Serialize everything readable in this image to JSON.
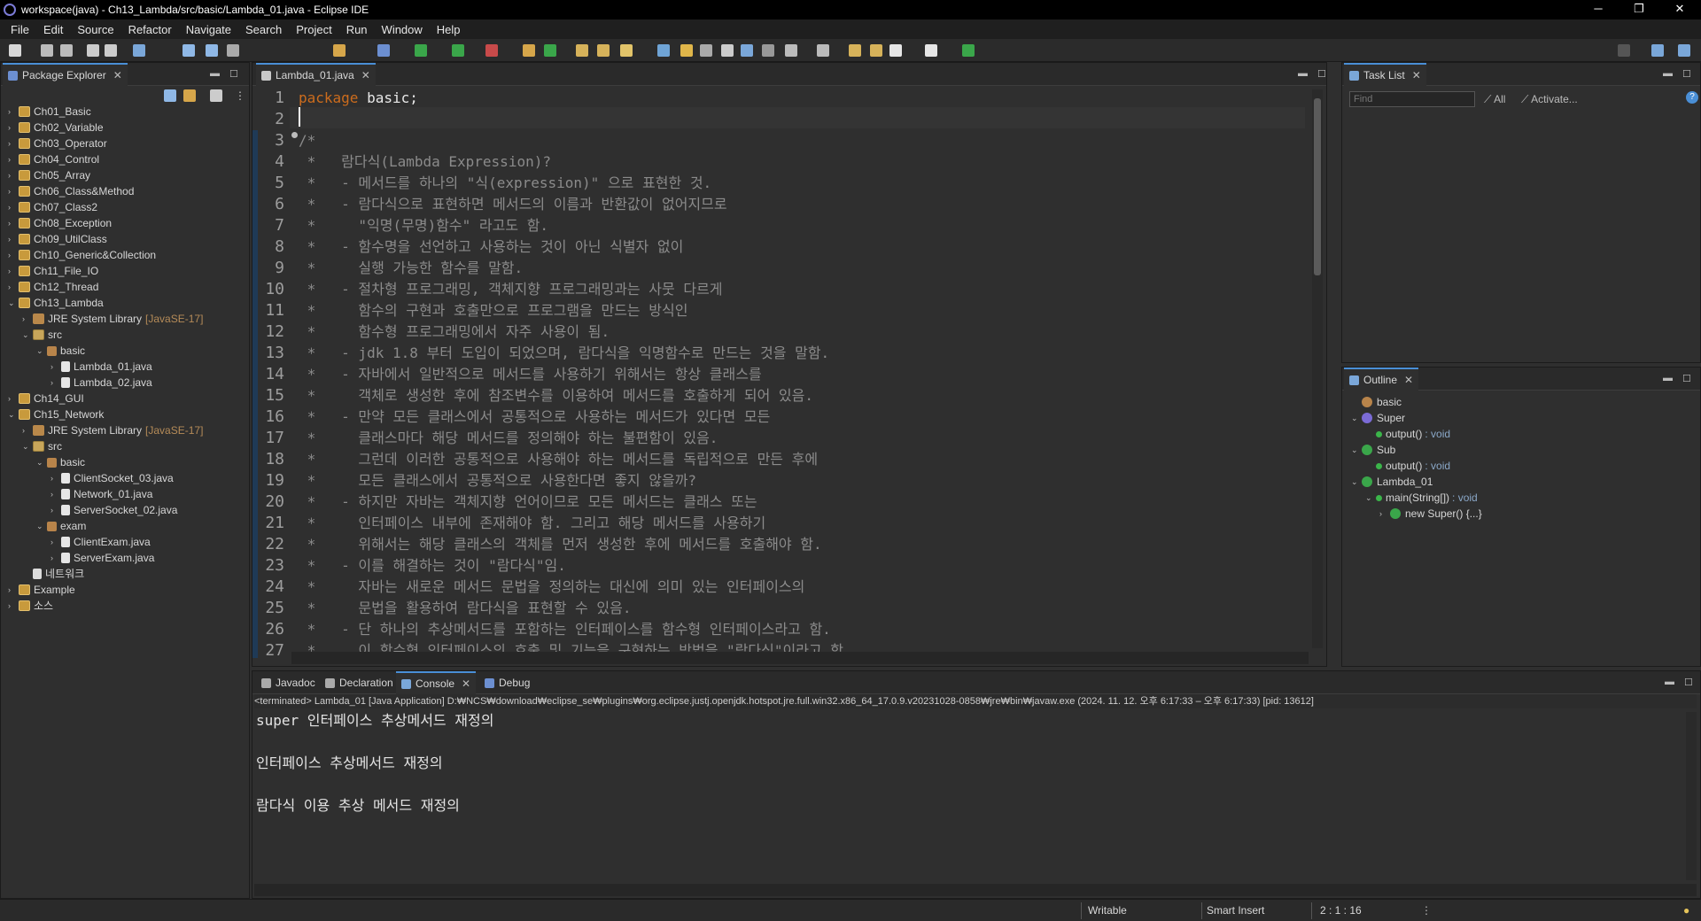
{
  "window": {
    "title": "workspace(java) - Ch13_Lambda/src/basic/Lambda_01.java - Eclipse IDE",
    "minimize": "─",
    "restore": "❐",
    "close": "✕"
  },
  "menu": [
    "File",
    "Edit",
    "Source",
    "Refactor",
    "Navigate",
    "Search",
    "Project",
    "Run",
    "Window",
    "Help"
  ],
  "package_explorer": {
    "tab": "Package Explorer",
    "tree": [
      {
        "label": "Ch01_Basic",
        "type": "proj",
        "depth": 0,
        "tw": "›"
      },
      {
        "label": "Ch02_Variable",
        "type": "proj",
        "depth": 0,
        "tw": "›"
      },
      {
        "label": "Ch03_Operator",
        "type": "proj",
        "depth": 0,
        "tw": "›"
      },
      {
        "label": "Ch04_Control",
        "type": "proj",
        "depth": 0,
        "tw": "›"
      },
      {
        "label": "Ch05_Array",
        "type": "proj",
        "depth": 0,
        "tw": "›"
      },
      {
        "label": "Ch06_Class&Method",
        "type": "proj",
        "depth": 0,
        "tw": "›"
      },
      {
        "label": "Ch07_Class2",
        "type": "proj",
        "depth": 0,
        "tw": "›"
      },
      {
        "label": "Ch08_Exception",
        "type": "proj",
        "depth": 0,
        "tw": "›"
      },
      {
        "label": "Ch09_UtilClass",
        "type": "proj",
        "depth": 0,
        "tw": "›"
      },
      {
        "label": "Ch10_Generic&Collection",
        "type": "proj",
        "depth": 0,
        "tw": "›"
      },
      {
        "label": "Ch11_File_IO",
        "type": "proj",
        "depth": 0,
        "tw": "›"
      },
      {
        "label": "Ch12_Thread",
        "type": "proj",
        "depth": 0,
        "tw": "›"
      },
      {
        "label": "Ch13_Lambda",
        "type": "proj",
        "depth": 0,
        "tw": "⌄"
      },
      {
        "label": "JRE System Library",
        "extra": "[JavaSE-17]",
        "type": "lib",
        "depth": 1,
        "tw": "›"
      },
      {
        "label": "src",
        "type": "src",
        "depth": 1,
        "tw": "⌄"
      },
      {
        "label": "basic",
        "type": "pkg",
        "depth": 2,
        "tw": "⌄"
      },
      {
        "label": "Lambda_01.java",
        "type": "java",
        "depth": 3,
        "tw": "›"
      },
      {
        "label": "Lambda_02.java",
        "type": "java",
        "depth": 3,
        "tw": "›"
      },
      {
        "label": "Ch14_GUI",
        "type": "proj",
        "depth": 0,
        "tw": "›"
      },
      {
        "label": "Ch15_Network",
        "type": "proj",
        "depth": 0,
        "tw": "⌄"
      },
      {
        "label": "JRE System Library",
        "extra": "[JavaSE-17]",
        "type": "lib",
        "depth": 1,
        "tw": "›"
      },
      {
        "label": "src",
        "type": "src",
        "depth": 1,
        "tw": "⌄"
      },
      {
        "label": "basic",
        "type": "pkg",
        "depth": 2,
        "tw": "⌄"
      },
      {
        "label": "ClientSocket_03.java",
        "type": "java",
        "depth": 3,
        "tw": "›"
      },
      {
        "label": "Network_01.java",
        "type": "java",
        "depth": 3,
        "tw": "›"
      },
      {
        "label": "ServerSocket_02.java",
        "type": "java",
        "depth": 3,
        "tw": "›"
      },
      {
        "label": "exam",
        "type": "pkg",
        "depth": 2,
        "tw": "⌄"
      },
      {
        "label": "ClientExam.java",
        "type": "java",
        "depth": 3,
        "tw": "›"
      },
      {
        "label": "ServerExam.java",
        "type": "java",
        "depth": 3,
        "tw": "›"
      },
      {
        "label": "네트워크",
        "type": "file",
        "depth": 1,
        "tw": ""
      },
      {
        "label": "Example",
        "type": "proj",
        "depth": 0,
        "tw": "›"
      },
      {
        "label": "소스",
        "type": "proj",
        "depth": 0,
        "tw": "›"
      }
    ]
  },
  "editor": {
    "tab": "Lambda_01.java",
    "lines": [
      {
        "n": "1",
        "kw": "package",
        "rest": " basic;"
      },
      {
        "n": "2",
        "text": ""
      },
      {
        "n": "3",
        "text": "/*"
      },
      {
        "n": "4",
        "text": " *   람다식(Lambda Expression)?"
      },
      {
        "n": "5",
        "text": " *   - 메서드를 하나의 \"식(expression)\" 으로 표현한 것."
      },
      {
        "n": "6",
        "text": " *   - 람다식으로 표현하면 메서드의 이름과 반환값이 없어지므로"
      },
      {
        "n": "7",
        "text": " *     \"익명(무명)함수\" 라고도 함."
      },
      {
        "n": "8",
        "text": " *   - 함수명을 선언하고 사용하는 것이 아닌 식별자 없이"
      },
      {
        "n": "9",
        "text": " *     실행 가능한 함수를 말함."
      },
      {
        "n": "10",
        "text": " *   - 절차형 프로그래밍, 객체지향 프로그래밍과는 사뭇 다르게"
      },
      {
        "n": "11",
        "text": " *     함수의 구현과 호출만으로 프로그램을 만드는 방식인"
      },
      {
        "n": "12",
        "text": " *     함수형 프로그래밍에서 자주 사용이 됨."
      },
      {
        "n": "13",
        "text": " *   - jdk 1.8 부터 도입이 되었으며, 람다식을 익명함수로 만드는 것을 말함."
      },
      {
        "n": "14",
        "text": " *   - 자바에서 일반적으로 메서드를 사용하기 위해서는 항상 클래스를"
      },
      {
        "n": "15",
        "text": " *     객체로 생성한 후에 참조변수를 이용하여 메서드를 호출하게 되어 있음."
      },
      {
        "n": "16",
        "text": " *   - 만약 모든 클래스에서 공통적으로 사용하는 메서드가 있다면 모든"
      },
      {
        "n": "17",
        "text": " *     클래스마다 해당 메서드를 정의해야 하는 불편함이 있음."
      },
      {
        "n": "18",
        "text": " *     그런데 이러한 공통적으로 사용해야 하는 메서드를 독립적으로 만든 후에"
      },
      {
        "n": "19",
        "text": " *     모든 클래스에서 공통적으로 사용한다면 좋지 않을까?"
      },
      {
        "n": "20",
        "text": " *   - 하지만 자바는 객체지향 언어이므로 모든 메서드는 클래스 또는"
      },
      {
        "n": "21",
        "text": " *     인터페이스 내부에 존재해야 함. 그리고 해당 메서드를 사용하기"
      },
      {
        "n": "22",
        "text": " *     위해서는 해당 클래스의 객체를 먼저 생성한 후에 메서드를 호출해야 함."
      },
      {
        "n": "23",
        "text": " *   - 이를 해결하는 것이 \"람다식\"임."
      },
      {
        "n": "24",
        "text": " *     자바는 새로운 메서드 문법을 정의하는 대신에 의미 있는 인터페이스의"
      },
      {
        "n": "25",
        "text": " *     문법을 활용하여 람다식을 표현할 수 있음."
      },
      {
        "n": "26",
        "text": " *   - 단 하나의 추상메서드를 포함하는 인터페이스를 함수형 인터페이스라고 함."
      },
      {
        "n": "27",
        "text": " *     이 함수형 인터페이스의 호출 및 기능을 구현하는 방법을 \"람다식\"이라고 함."
      }
    ]
  },
  "tasklist": {
    "tab": "Task List",
    "find_placeholder": "Find",
    "all": "All",
    "activate": "Activate..."
  },
  "outline": {
    "tab": "Outline",
    "items": [
      {
        "label": "basic",
        "kind": "pkg",
        "depth": 0,
        "tw": ""
      },
      {
        "label": "Super",
        "kind": "iface",
        "depth": 0,
        "tw": "⌄"
      },
      {
        "label": "output()",
        "type": ": void",
        "kind": "method",
        "depth": 1,
        "tw": ""
      },
      {
        "label": "Sub",
        "kind": "class",
        "depth": 0,
        "tw": "⌄"
      },
      {
        "label": "output()",
        "type": ": void",
        "kind": "method",
        "depth": 1,
        "tw": ""
      },
      {
        "label": "Lambda_01",
        "kind": "class",
        "depth": 0,
        "tw": "⌄"
      },
      {
        "label": "main(String[])",
        "type": ": void",
        "kind": "method",
        "depth": 1,
        "tw": "⌄"
      },
      {
        "label": "new Super() {...}",
        "kind": "anon",
        "depth": 2,
        "tw": "›"
      }
    ]
  },
  "bottom": {
    "tabs": [
      "Javadoc",
      "Declaration",
      "Console",
      "Debug"
    ],
    "active": "Console",
    "terminated": "<terminated> Lambda_01 [Java Application] D:₩NCS₩download₩eclipse_se₩plugins₩org.eclipse.justj.openjdk.hotspot.jre.full.win32.x86_64_17.0.9.v20231028-0858₩jre₩bin₩javaw.exe  (2024. 11. 12. 오후 6:17:33 – 오후 6:17:33) [pid: 13612]",
    "output": [
      "super 인터페이스 추상메서드 재정의",
      "인터페이스 추상메서드 재정의",
      "람다식 이용 추상 메서드 재정의"
    ]
  },
  "status": {
    "writable": "Writable",
    "insert": "Smart Insert",
    "position": "2 : 1 : 16"
  },
  "colors": {
    "accent": "#4a8fd6",
    "keyword": "#cc6c1d",
    "comment": "#8b8b8b"
  }
}
